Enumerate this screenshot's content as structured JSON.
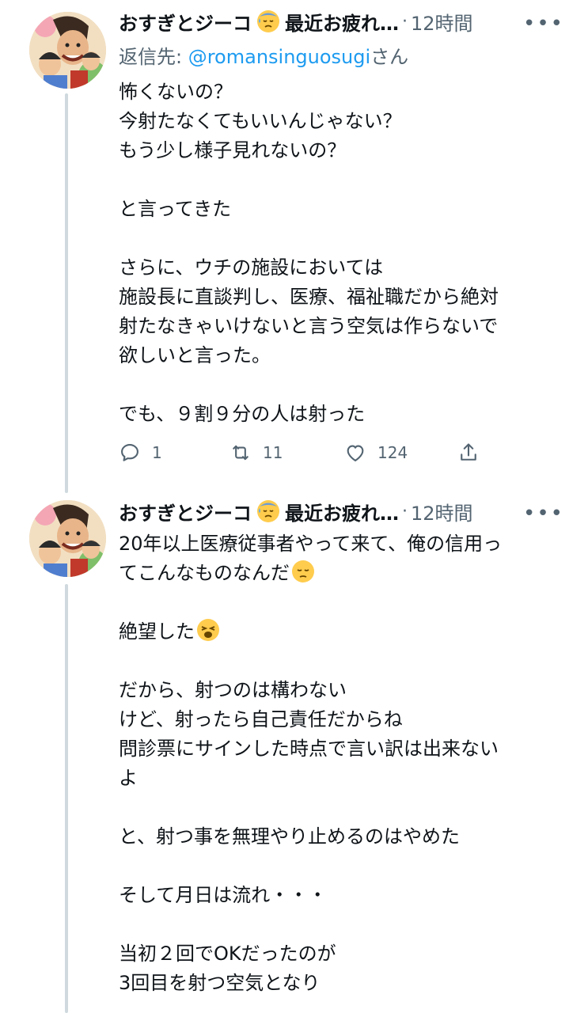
{
  "tweets": [
    {
      "author": "おすぎとジーコ",
      "author_suffix": "最近お疲れ…",
      "dot": "·",
      "time": "12時間",
      "more": "•••",
      "reply_prefix": "返信先: ",
      "reply_handle": "@romansinguosugi",
      "reply_suffix": "さん",
      "lines": [
        "怖くないの？",
        "今射たなくてもいいんじゃない？",
        "もう少し様子見れないの？",
        "",
        "と言ってきた",
        "",
        "さらに、ウチの施設においては",
        "施設長に直談判し、医療、福祉職だから絶対",
        "射たなきゃいけないと言う空気は作らないで",
        "欲しいと言った。",
        "",
        "でも、９割９分の人は射った"
      ],
      "actions": {
        "reply": "1",
        "retweet": "11",
        "like": "124"
      }
    },
    {
      "author": "おすぎとジーコ",
      "author_suffix": "最近お疲れ…",
      "dot": "·",
      "time": "12時間",
      "more": "•••",
      "lines": [
        "20年以上医療従事者やって来て、俺の信用っ",
        "てこんなものなんだ",
        "",
        "絶望した",
        "",
        "だから、射つのは構わない",
        "けど、射ったら自己責任だからね",
        "問診票にサインした時点で言い訳は出来ない",
        "よ",
        "",
        "と、射つ事を無理やり止めるのはやめた",
        "",
        "そして月日は流れ・・・",
        "",
        "当初２回でOKだったのが",
        "3回目を射つ空気となり"
      ]
    }
  ],
  "colors": {
    "text": "#0f1419",
    "secondary": "#536471",
    "link": "#1d9bf0",
    "thread": "#cfd9de"
  }
}
